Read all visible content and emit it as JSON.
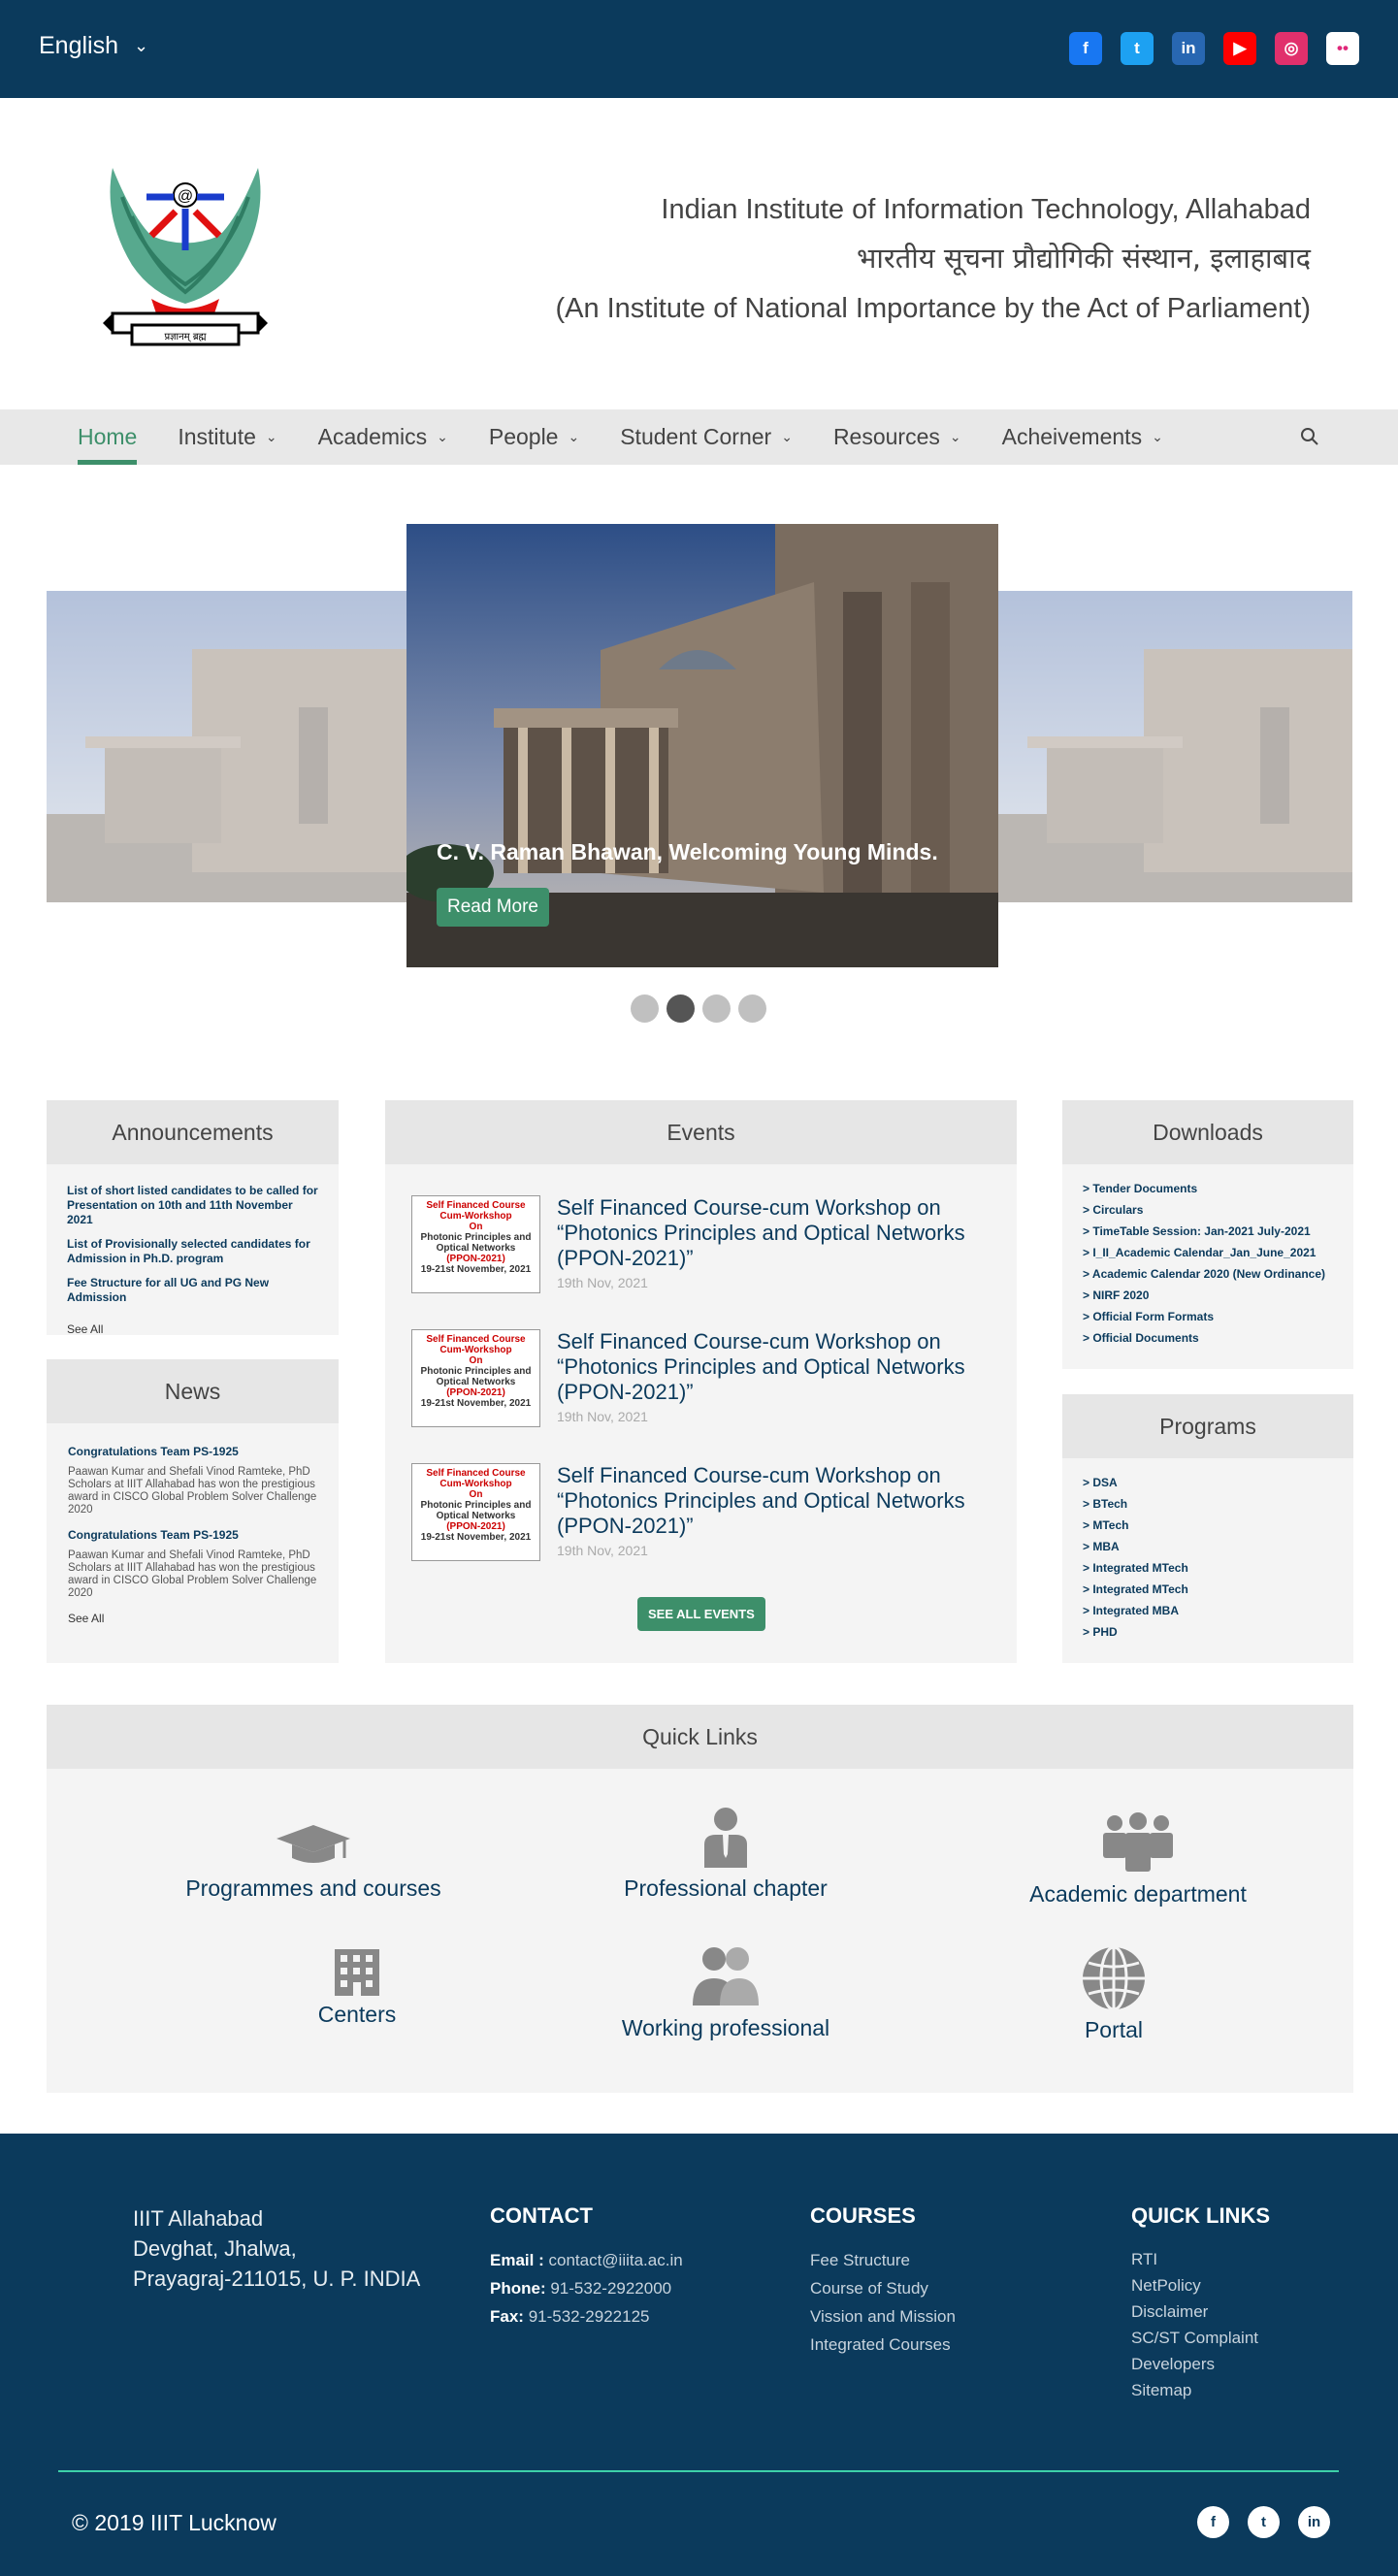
{
  "topbar": {
    "language": "English",
    "social": [
      {
        "icon": "facebook-icon",
        "glyph": "f",
        "color": "#1877f2"
      },
      {
        "icon": "twitter-icon",
        "glyph": "t",
        "color": "#1da1f2"
      },
      {
        "icon": "linkedin-icon",
        "glyph": "in",
        "color": "#2867b2"
      },
      {
        "icon": "youtube-icon",
        "glyph": "▶",
        "color": "#ff0000"
      },
      {
        "icon": "instagram-icon",
        "glyph": "◎",
        "color": "#e1306c"
      },
      {
        "icon": "flickr-icon",
        "glyph": "••",
        "color": "#ffffff"
      }
    ]
  },
  "header": {
    "name_en": "Indian Institute of Information Technology, Allahabad",
    "name_hi": "भारतीय सूचना प्रौद्योगिकी संस्थान, इलाहाबाद",
    "tagline": "(An Institute of National Importance by the Act of Parliament)",
    "logo_text": "प्रज्ञानम् ब्रह्म"
  },
  "nav": {
    "items": [
      "Home",
      "Institute",
      "Academics",
      "People",
      "Student Corner",
      "Resources",
      "Acheivements"
    ],
    "active": "Home"
  },
  "carousel": {
    "caption": "C. V. Raman Bhawan, Welcoming Young Minds.",
    "button": "Read More",
    "slides": 4,
    "active_slide": 2
  },
  "announcements": {
    "title": "Announcements",
    "items": [
      "List of short listed candidates to be called for Presentation on 10th and 11th November 2021",
      "List of Provisionally selected candidates for Admission in Ph.D. program",
      "Fee Structure for all UG and PG New Admission"
    ],
    "see_all": "See All"
  },
  "news": {
    "title": "News",
    "items": [
      {
        "title": "Congratulations Team PS-1925",
        "body": "Paawan Kumar and Shefali Vinod Ramteke, PhD Scholars at IIIT Allahabad has won the prestigious award in CISCO Global Problem Solver Challenge 2020"
      },
      {
        "title": "Congratulations Team PS-1925",
        "body": "Paawan Kumar and Shefali Vinod Ramteke, PhD Scholars at IIIT Allahabad has won the prestigious award in CISCO Global Problem Solver Challenge 2020"
      }
    ],
    "see_all": "See All"
  },
  "events": {
    "title": "Events",
    "items": [
      {
        "title": "Self Financed Course-cum Workshop on “Photonics Principles and Optical Networks (PPON-2021)”",
        "date": "19th Nov, 2021",
        "thumb": [
          "Self Financed Course",
          "Cum-Workshop",
          "On",
          "Photonic Principles and",
          "Optical Networks",
          "(PPON-2021)",
          "19-21st November, 2021"
        ]
      },
      {
        "title": "Self Financed Course-cum Workshop on “Photonics Principles and Optical Networks (PPON-2021)”",
        "date": "19th Nov, 2021",
        "thumb": [
          "Self Financed Course",
          "Cum-Workshop",
          "On",
          "Photonic Principles and",
          "Optical Networks",
          "(PPON-2021)",
          "19-21st November, 2021"
        ]
      },
      {
        "title": "Self Financed Course-cum Workshop on “Photonics Principles and Optical Networks (PPON-2021)”",
        "date": "19th Nov, 2021",
        "thumb": [
          "Self Financed Course",
          "Cum-Workshop",
          "On",
          "Photonic Principles and",
          "Optical Networks",
          "(PPON-2021)",
          "19-21st November, 2021"
        ]
      }
    ],
    "see_all": "SEE ALL EVENTS"
  },
  "downloads": {
    "title": "Downloads",
    "items": [
      "> Tender Documents",
      "> Circulars",
      "> TimeTable Session: Jan-2021 July-2021",
      "> I_II_Academic Calendar_Jan_June_2021",
      "> Academic Calendar 2020 (New Ordinance)",
      "> NIRF 2020",
      "> Official Form Formats",
      "> Official Documents"
    ]
  },
  "programs": {
    "title": "Programs",
    "items": [
      "> DSA",
      "> BTech",
      "> MTech",
      "> MBA",
      "> Integrated MTech",
      "> Integrated MTech",
      "> Integrated MBA",
      "> PHD"
    ]
  },
  "quick_links": {
    "title": "Quick Links",
    "items": [
      {
        "label": "Programmes and courses",
        "icon": "graduation-cap-icon"
      },
      {
        "label": "Professional chapter",
        "icon": "professional-icon"
      },
      {
        "label": "Academic department",
        "icon": "group-icon"
      },
      {
        "label": "Centers",
        "icon": "building-icon"
      },
      {
        "label": "Working professional",
        "icon": "users-icon"
      },
      {
        "label": "Portal",
        "icon": "globe-icon"
      }
    ]
  },
  "footer": {
    "address": [
      "IIIT Allahabad",
      "Devghat, Jhalwa,",
      "Prayagraj-211015, U. P. INDIA"
    ],
    "contact": {
      "title": "CONTACT",
      "email_label": "Email :",
      "email": "contact@iiita.ac.in",
      "phone_label": "Phone:",
      "phone": "91-532-2922000",
      "fax_label": "Fax:",
      "fax": "91-532-2922125"
    },
    "courses": {
      "title": "COURSES",
      "items": [
        "Fee Structure",
        "Course of Study",
        "Vission and Mission",
        "Integrated Courses"
      ]
    },
    "quick_links": {
      "title": "QUICK LINKS",
      "items": [
        "RTI",
        "NetPolicy",
        "Disclaimer",
        "SC/ST Complaint",
        "Developers",
        "Sitemap"
      ]
    },
    "copyright": "© 2019 IIIT Lucknow",
    "social": [
      {
        "icon": "facebook-icon",
        "glyph": "f"
      },
      {
        "icon": "twitter-icon",
        "glyph": "t"
      },
      {
        "icon": "linkedin-icon",
        "glyph": "in"
      }
    ]
  }
}
